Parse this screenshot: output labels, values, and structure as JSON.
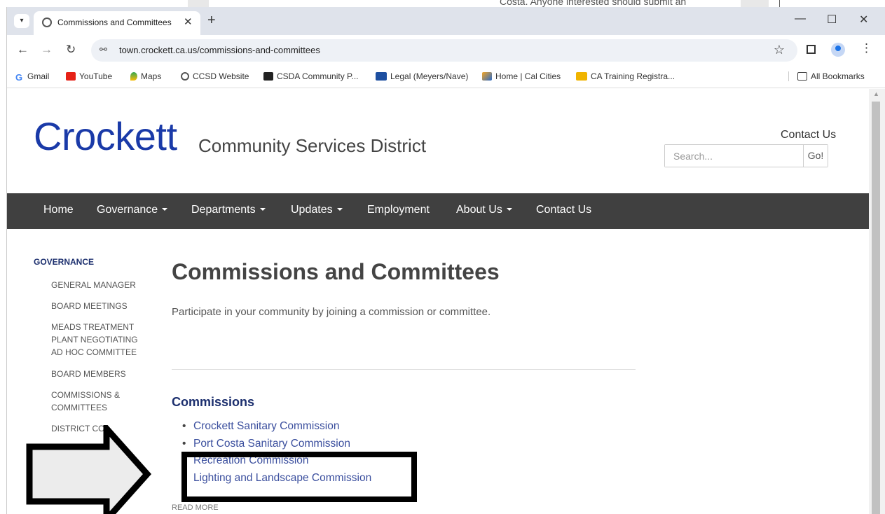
{
  "background": {
    "text": "Costa. Anyone interested should submit an"
  },
  "browser": {
    "tab_title": "Commissions and Committees",
    "url": "town.crockett.ca.us/commissions-and-committees",
    "window_controls": {
      "minimize": "—",
      "maximize": "☐",
      "close": "✕"
    },
    "bookmarks": [
      {
        "label": "Gmail",
        "icon": "gmail-icon"
      },
      {
        "label": "YouTube",
        "icon": "youtube-icon"
      },
      {
        "label": "Maps",
        "icon": "maps-icon"
      },
      {
        "label": "CCSD Website",
        "icon": "globe-icon"
      },
      {
        "label": "CSDA Community P...",
        "icon": "csda-icon"
      },
      {
        "label": "Legal (Meyers/Nave)",
        "icon": "mn-icon"
      },
      {
        "label": "Home | Cal Cities",
        "icon": "calcities-icon"
      },
      {
        "label": "CA Training Registra...",
        "icon": "hr-icon"
      }
    ],
    "all_bookmarks": "All Bookmarks"
  },
  "site": {
    "logo_main": "Crockett",
    "logo_sub": "Community Services District",
    "contact_top": "Contact Us",
    "search_placeholder": "Search...",
    "search_button": "Go!",
    "nav": [
      {
        "label": "Home",
        "dropdown": false
      },
      {
        "label": "Governance",
        "dropdown": true
      },
      {
        "label": "Departments",
        "dropdown": true
      },
      {
        "label": "Updates",
        "dropdown": true
      },
      {
        "label": "Employment",
        "dropdown": false
      },
      {
        "label": "About Us",
        "dropdown": true
      },
      {
        "label": "Contact Us",
        "dropdown": false
      }
    ]
  },
  "sidebar": {
    "heading": "GOVERNANCE",
    "items": [
      "GENERAL MANAGER",
      "BOARD MEETINGS",
      "MEADS TREATMENT PLANT NEGOTIATING AD HOC COMMITTEE",
      "BOARD MEMBERS",
      "COMMISSIONS & COMMITTEES",
      "DISTRICT CO"
    ]
  },
  "main": {
    "title": "Commissions and Committees",
    "intro": "Participate in your community by joining  a commission or committee.",
    "section_heading": "Commissions",
    "commissions": [
      "Crockett Sanitary Commission",
      "Port Costa Sanitary Commission",
      "Recreation Commission",
      "Lighting and Landscape Commission"
    ],
    "read_more": "READ MORE"
  }
}
